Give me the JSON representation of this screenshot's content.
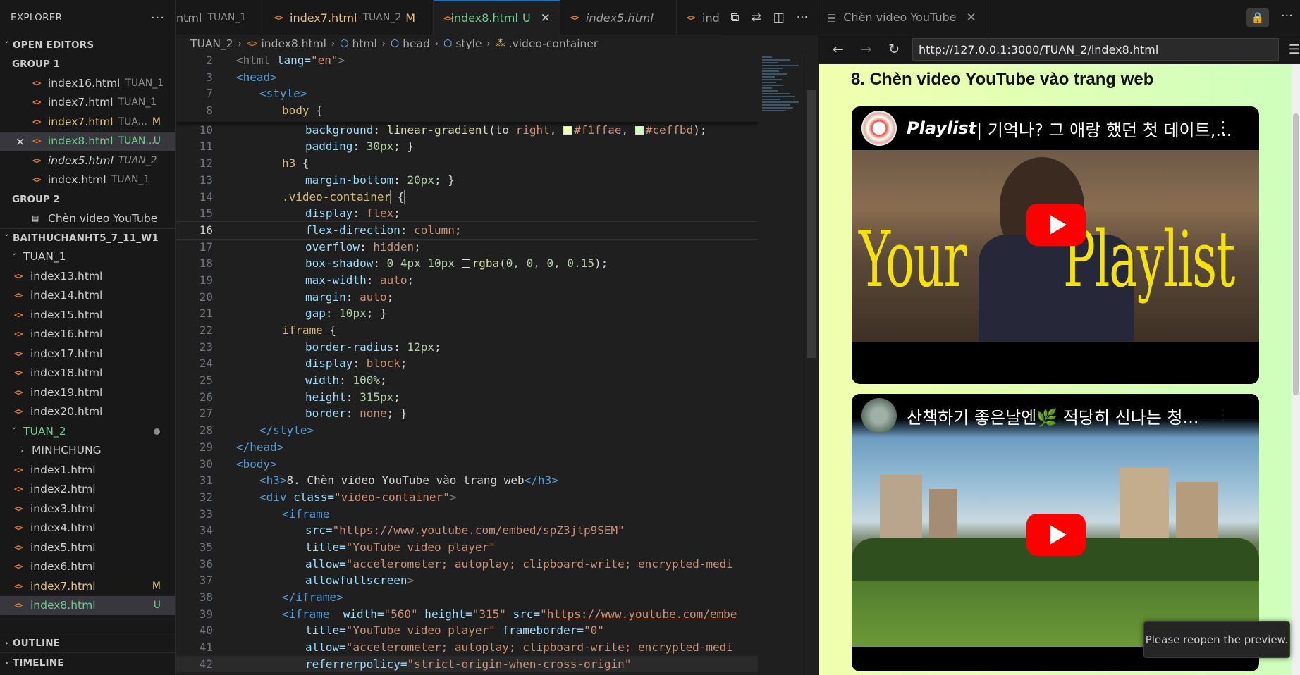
{
  "explorer": {
    "title": "EXPLORER",
    "open_editors_label": "OPEN EDITORS",
    "group1_label": "GROUP 1",
    "group2_label": "GROUP 2",
    "open_editors_g1": [
      {
        "name": "index16.html",
        "folder": "TUAN_1",
        "badge": ""
      },
      {
        "name": "index7.html",
        "folder": "TUAN_1",
        "badge": ""
      },
      {
        "name": "index7.html",
        "folder": "TUA...",
        "badge": "M"
      },
      {
        "name": "index8.html",
        "folder": "TUAN...",
        "badge": "U"
      },
      {
        "name": "index5.html",
        "folder": "TUAN_2",
        "badge": ""
      },
      {
        "name": "index.html",
        "folder": "TUAN_1",
        "badge": ""
      }
    ],
    "open_editors_g2": [
      {
        "name": "Chèn video YouTube"
      }
    ],
    "workspace_label": "BAITHUCHANHT5_7_11_W1",
    "tuan1_label": "TUAN_1",
    "tuan1_files": [
      "index13.html",
      "index14.html",
      "index15.html",
      "index16.html",
      "index17.html",
      "index18.html",
      "index19.html",
      "index20.html"
    ],
    "tuan2_label": "TUAN_2",
    "minhchung_label": "MINHCHUNG",
    "tuan2_files": [
      {
        "name": "index1.html",
        "badge": ""
      },
      {
        "name": "index2.html",
        "badge": ""
      },
      {
        "name": "index3.html",
        "badge": ""
      },
      {
        "name": "index4.html",
        "badge": ""
      },
      {
        "name": "index5.html",
        "badge": ""
      },
      {
        "name": "index6.html",
        "badge": ""
      },
      {
        "name": "index7.html",
        "badge": "M"
      },
      {
        "name": "index8.html",
        "badge": "U"
      }
    ],
    "outline_label": "OUTLINE",
    "timeline_label": "TIMELINE"
  },
  "tabs": [
    {
      "name": "ntml",
      "folder": "TUAN_1",
      "badge": ""
    },
    {
      "name": "index7.html",
      "folder": "TUAN_2",
      "badge": "M"
    },
    {
      "name": "index8.html",
      "folder": "",
      "badge": "U"
    },
    {
      "name": "index5.html",
      "folder": "",
      "badge": ""
    },
    {
      "name": "ind",
      "folder": "",
      "badge": ""
    }
  ],
  "breadcrumb": [
    "TUAN_2",
    "index8.html",
    "html",
    "head",
    "style",
    ".video-container"
  ],
  "code_lines": [
    2,
    3,
    7,
    8,
    10,
    11,
    12,
    13,
    14,
    15,
    16,
    17,
    18,
    19,
    20,
    21,
    22,
    23,
    24,
    25,
    26,
    27,
    28,
    29,
    30,
    31,
    32,
    33,
    34,
    35,
    36,
    37,
    38,
    39,
    40,
    41,
    42
  ],
  "code_text": {
    "l2a": "<html",
    "l2b": " lang=",
    "l2c": "\"en\"",
    "l2d": ">",
    "l3": "<head>",
    "l7": "<style>",
    "l8a": "body",
    "l8b": " {",
    "l10a": "background",
    "l10b": ": ",
    "l10c": "linear-gradient",
    "l10d": "(to ",
    "l10e": "right",
    "l10f": ", ",
    "l10g": "#f1ffae",
    "l10h": ", ",
    "l10i": "#ceffbd",
    "l10j": ");",
    "l11a": "padding",
    "l11b": ": ",
    "l11c": "30px",
    "l11d": "; }",
    "l12a": "h3",
    "l12b": " {",
    "l13a": "margin-bottom",
    "l13b": ": ",
    "l13c": "20px",
    "l13d": "; }",
    "l14a": ".video-container",
    "l14b": " {",
    "l15a": "display",
    "l15b": ": ",
    "l15c": "flex",
    "l15d": ";",
    "l16a": "flex-direction",
    "l16b": ": ",
    "l16c": "column",
    "l16d": ";",
    "l17a": "overflow",
    "l17b": ": ",
    "l17c": "hidden",
    "l17d": ";",
    "l18a": "box-shadow",
    "l18b": ": ",
    "l18c": "0 4px 10px",
    "l18e": "rgba",
    "l18f": "(",
    "l18g": "0, 0, 0, 0.15",
    "l18h": ");",
    "l19a": "max-width",
    "l19b": ": ",
    "l19c": "auto",
    "l19d": ";",
    "l20a": "margin",
    "l20b": ": ",
    "l20c": "auto",
    "l20d": ";",
    "l21a": "gap",
    "l21b": ": ",
    "l21c": "10px",
    "l21d": "; }",
    "l22a": "iframe",
    "l22b": " {",
    "l23a": "border-radius",
    "l23b": ": ",
    "l23c": "12px",
    "l23d": ";",
    "l24a": "display",
    "l24b": ": ",
    "l24c": "block",
    "l24d": ";",
    "l25a": "width",
    "l25b": ": ",
    "l25c": "100%",
    "l25d": ";",
    "l26a": "height",
    "l26b": ": ",
    "l26c": "315px",
    "l26d": ";",
    "l27a": "border",
    "l27b": ": ",
    "l27c": "none",
    "l27d": "; }",
    "l28": "</style>",
    "l29": "</head>",
    "l30": "<body>",
    "l31a": "<h3>",
    "l31b": "8. Chèn video YouTube vào trang web",
    "l31c": "</h3>",
    "l32a": "<div",
    "l32b": " class=",
    "l32c": "\"video-container\"",
    "l32d": ">",
    "l33": "<iframe",
    "l34a": "src=",
    "l34b": "\"",
    "l34c": "https://www.youtube.com/embed/spZ3jtp9SEM",
    "l34d": "\"",
    "l35a": "title=",
    "l35b": "\"YouTube video player\"",
    "l36a": "allow=",
    "l36b": "\"accelerometer; autoplay; clipboard-write; encrypted-medi",
    "l37a": "allowfullscreen",
    "l37b": ">",
    "l38": "</iframe>",
    "l39a": "<iframe",
    "l39b": "  width=",
    "l39c": "\"560\"",
    "l39d": " height=",
    "l39e": "\"315\"",
    "l39f": " src=",
    "l39g": "\"",
    "l39h": "https://www.youtube.com/embe",
    "l40a": "title=",
    "l40b": "\"YouTube video player\"",
    "l40c": " frameborder=",
    "l40d": "\"0\"",
    "l41a": "allow=",
    "l41b": "\"accelerometer; autoplay; clipboard-write; encrypted-medi",
    "l42a": "referrerpolicy=",
    "l42b": "\"strict-origin-when-cross-origin\""
  },
  "preview": {
    "tab_title": "Chèn video YouTube",
    "url": "http://127.0.0.1:3000/TUAN_2/index8.html",
    "heading": "8. Chèn video YouTube vào trang web",
    "video1_title_bold": "Playlist",
    "video1_title_rest": "| 기억나? 그 애랑 했던 첫 데이트,...",
    "video1_overlay_left": "Your",
    "video1_overlay_right": "Playlist",
    "video2_title": "산책하기 좋은날엔🌿 적당히 신나는 청...",
    "toast": "Please reopen the preview."
  },
  "colors": {
    "accent": "#0078d4",
    "modified": "#e2c08d",
    "untracked": "#73c991",
    "gradient_left": "#f1ffae",
    "gradient_right": "#ceffbd",
    "play_red": "#ff0000"
  },
  "icons": {
    "html_file": "html-file-icon",
    "close": "close-icon",
    "more": "ellipsis-icon",
    "lock": "lock-icon",
    "back": "arrow-left-icon",
    "forward": "arrow-right-icon",
    "reload": "reload-icon",
    "menu": "hamburger-icon"
  }
}
